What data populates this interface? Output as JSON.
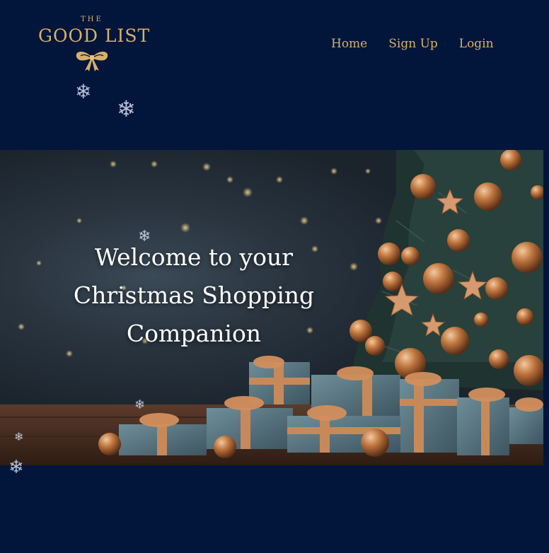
{
  "logo": {
    "top_word": "THE",
    "main_text": "GOOD LIST"
  },
  "nav": {
    "items": [
      "Home",
      "Sign Up",
      "Login"
    ]
  },
  "hero": {
    "title": "Welcome to your Christmas Shopping Companion"
  },
  "colors": {
    "background": "#02153a",
    "accent_gold": "#d6b06b",
    "hero_text": "#ffffff"
  }
}
